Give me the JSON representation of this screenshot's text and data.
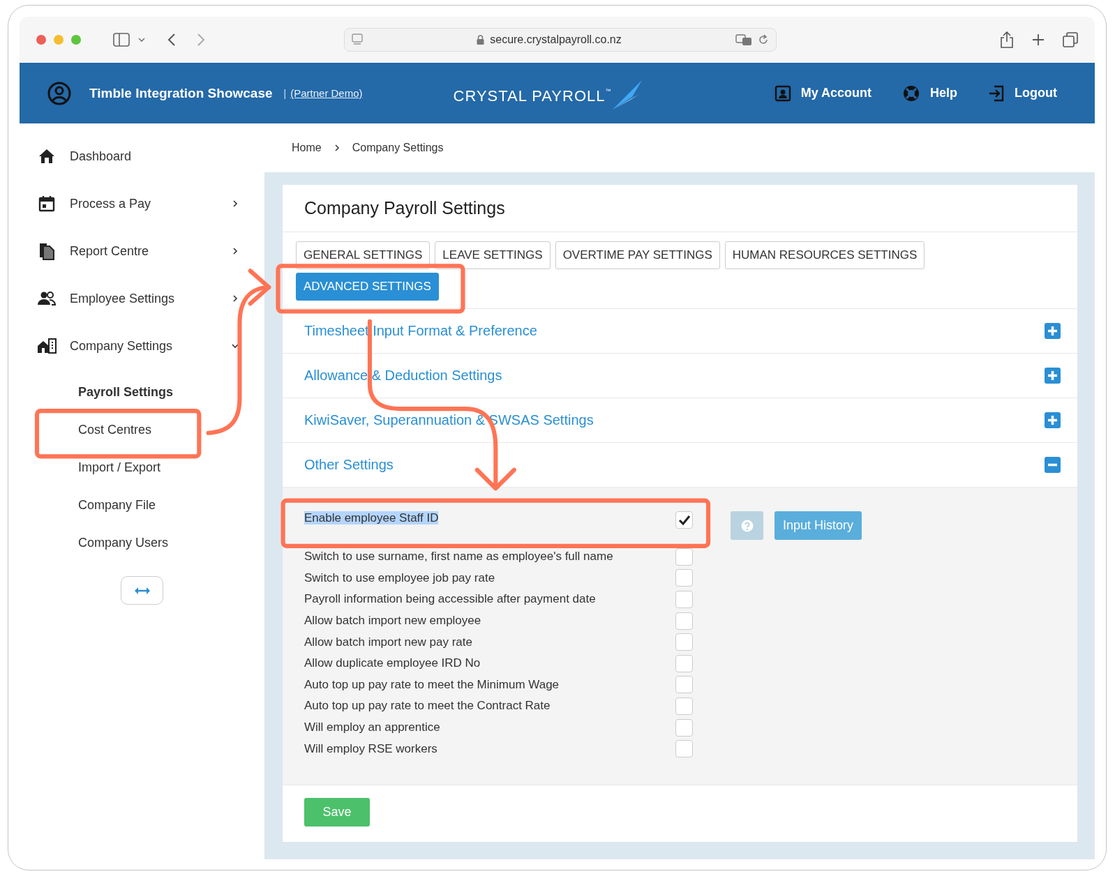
{
  "browser": {
    "url": "secure.crystalpayroll.co.nz"
  },
  "header": {
    "company": "Timble Integration Showcase",
    "separator": "|",
    "partner_link": "(Partner Demo)",
    "logo": "CRYSTAL PAYROLL",
    "logo_mark": "™",
    "nav": [
      {
        "label": "My Account"
      },
      {
        "label": "Help"
      },
      {
        "label": "Logout"
      }
    ]
  },
  "sidebar": {
    "items": [
      {
        "label": "Dashboard",
        "kind": "link"
      },
      {
        "label": "Process a Pay",
        "kind": "menu",
        "expanded": false
      },
      {
        "label": "Report Centre",
        "kind": "menu",
        "expanded": false
      },
      {
        "label": "Employee Settings",
        "kind": "menu",
        "expanded": false
      },
      {
        "label": "Company Settings",
        "kind": "menu",
        "expanded": true,
        "children": [
          {
            "label": "Payroll Settings",
            "selected": true
          },
          {
            "label": "Cost Centres",
            "selected": false
          },
          {
            "label": "Import / Export",
            "selected": false
          },
          {
            "label": "Company File",
            "selected": false
          },
          {
            "label": "Company Users",
            "selected": false
          }
        ]
      }
    ]
  },
  "breadcrumb": [
    "Home",
    "Company Settings"
  ],
  "card": {
    "title": "Company Payroll Settings",
    "tabs": [
      {
        "label": "GENERAL SETTINGS",
        "selected": false
      },
      {
        "label": "LEAVE SETTINGS",
        "selected": false
      },
      {
        "label": "OVERTIME PAY SETTINGS",
        "selected": false
      },
      {
        "label": "HUMAN RESOURCES SETTINGS",
        "selected": false
      },
      {
        "label": "ADVANCED SETTINGS",
        "selected": true
      }
    ],
    "sections": [
      {
        "title": "Timesheet Input Format & Preference",
        "expanded": false
      },
      {
        "title": "Allowance & Deduction Settings",
        "expanded": false
      },
      {
        "title": "KiwiSaver, Superannuation & SWSAS Settings",
        "expanded": false
      },
      {
        "title": "Other Settings",
        "expanded": true
      }
    ],
    "settings": [
      {
        "label": "Enable employee Staff ID",
        "checked": true,
        "highlighted": true
      },
      {
        "label": "Switch to use surname, first name as employee's full name",
        "checked": false,
        "highlighted": false
      },
      {
        "label": "Switch to use employee job pay rate",
        "checked": false,
        "highlighted": false
      },
      {
        "label": "Payroll information being accessible after payment date",
        "checked": false,
        "highlighted": false
      },
      {
        "label": "Allow batch import new employee",
        "checked": false,
        "highlighted": false
      },
      {
        "label": "Allow batch import new pay rate",
        "checked": false,
        "highlighted": false
      },
      {
        "label": "Allow duplicate employee IRD No",
        "checked": false,
        "highlighted": false
      },
      {
        "label": "Auto top up pay rate to meet the Minimum Wage",
        "checked": false,
        "highlighted": false
      },
      {
        "label": "Auto top up pay rate to meet the Contract Rate",
        "checked": false,
        "highlighted": false
      },
      {
        "label": "Will employ an apprentice",
        "checked": false,
        "highlighted": false
      },
      {
        "label": "Will employ RSE workers",
        "checked": false,
        "highlighted": false
      }
    ],
    "history_button": "Input History",
    "save_button": "Save"
  }
}
